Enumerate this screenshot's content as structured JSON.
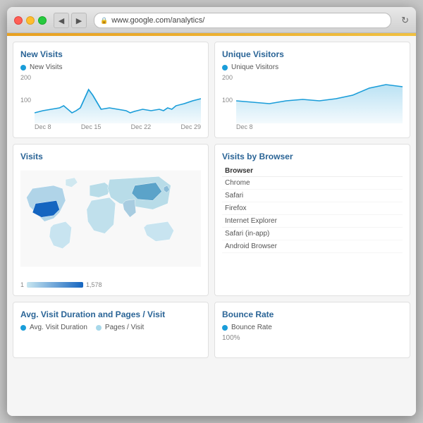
{
  "window": {
    "url": "www.google.com/analytics/",
    "back_btn": "◀",
    "forward_btn": "▶",
    "refresh_btn": "↻"
  },
  "new_visits": {
    "title": "New Visits",
    "legend": "New Visits",
    "y_max": "200",
    "y_mid": "100",
    "x_labels": [
      "Dec 8",
      "Dec 15",
      "Dec 22",
      "Dec 29"
    ],
    "dot_color": "#1a9dd9"
  },
  "unique_visitors": {
    "title": "Unique Visitors",
    "legend": "Unique Visitors",
    "y_max": "200",
    "y_mid": "100",
    "x_labels": [
      "Dec 8"
    ],
    "dot_color": "#1a9dd9"
  },
  "visits_map": {
    "title": "Visits",
    "scale_min": "1",
    "scale_max": "1,578"
  },
  "visits_by_browser": {
    "title": "Visits by Browser",
    "col_header": "Browser",
    "rows": [
      {
        "browser": "Chrome"
      },
      {
        "browser": "Safari"
      },
      {
        "browser": "Firefox"
      },
      {
        "browser": "Internet Explorer"
      },
      {
        "browser": "Safari (in-app)"
      },
      {
        "browser": "Android Browser"
      }
    ]
  },
  "bounce_rate": {
    "title": "Bounce Rate",
    "legend": "Bounce Rate",
    "y_label": "100%",
    "dot_color": "#1a9dd9"
  },
  "avg_visit": {
    "title": "Avg. Visit Duration and Pages / Visit",
    "legend1": "Avg. Visit Duration",
    "legend2": "Pages / Visit",
    "dot_color1": "#1a9dd9",
    "dot_color2": "#a8d8ea"
  }
}
